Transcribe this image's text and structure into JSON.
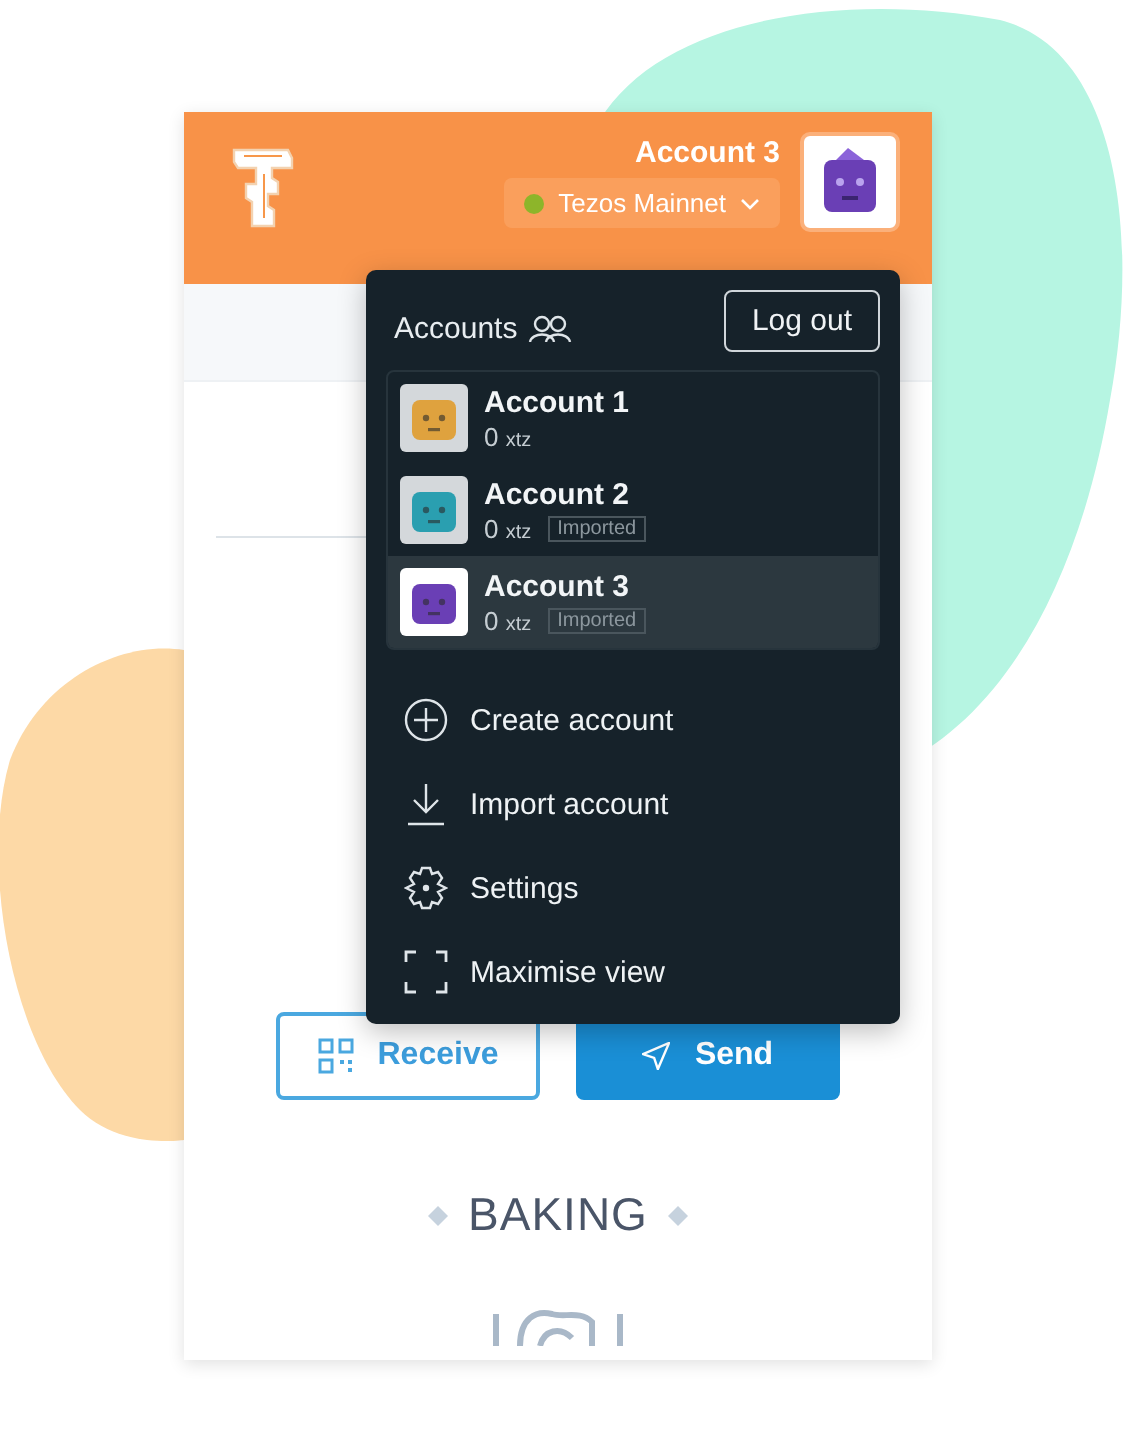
{
  "header": {
    "account_name": "Account 3",
    "network": {
      "name": "Tezos Mainnet",
      "connected": true
    }
  },
  "actions": [
    {
      "label": "Receive",
      "kind": "receive"
    },
    {
      "label": "Send",
      "kind": "send"
    }
  ],
  "section_title": "BAKING",
  "dropdown": {
    "title": "Accounts",
    "logout": "Log out",
    "accounts": [
      {
        "name": "Account 1",
        "balance": "0",
        "unit": "xtz",
        "color": "#dfa23e",
        "selected": false
      },
      {
        "name": "Account 2",
        "balance": "0",
        "unit": "xtz",
        "tag": "Imported",
        "color": "#2a9fb0",
        "selected": false
      },
      {
        "name": "Account 3",
        "balance": "0",
        "unit": "xtz",
        "tag": "Imported",
        "color": "#6a3fb5",
        "selected": true
      }
    ],
    "menu": [
      {
        "label": "Create account",
        "kind": "create"
      },
      {
        "label": "Import account",
        "kind": "import"
      },
      {
        "label": "Settings",
        "kind": "settings"
      },
      {
        "label": "Maximise view",
        "kind": "maximise"
      }
    ]
  }
}
